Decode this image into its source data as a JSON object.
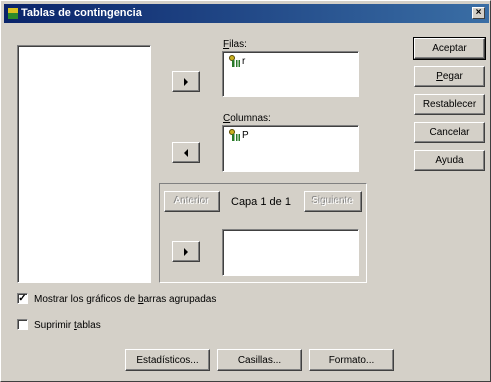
{
  "window": {
    "title": "Tablas de contingencia",
    "close_label": "×"
  },
  "filas": {
    "label_prefix": "",
    "label_ul": "F",
    "label_rest": "ilas:",
    "items": [
      "r"
    ]
  },
  "columnas": {
    "label_ul": "C",
    "label_rest": "olumnas:",
    "items": [
      "P"
    ]
  },
  "layer": {
    "prev_label": "Anterior",
    "text": "Capa 1 de 1",
    "next_label": "Siguiente"
  },
  "buttons": {
    "aceptar": "Aceptar",
    "pegar_ul": "P",
    "pegar_rest": "egar",
    "restablecer": "Restablecer",
    "cancelar": "Cancelar",
    "ayuda": "Ayuda"
  },
  "options": {
    "mostrar_pre": "Mostrar los gráficos de ",
    "mostrar_ul": "b",
    "mostrar_post": "arras agrupadas",
    "mostrar_checked": "✓",
    "suprimir_pre": "Suprimir ",
    "suprimir_ul": "t",
    "suprimir_post": "ablas"
  },
  "bottom": {
    "estadisticos": "Estadísticos...",
    "casillas": "Casillas...",
    "formato": "Formato..."
  }
}
